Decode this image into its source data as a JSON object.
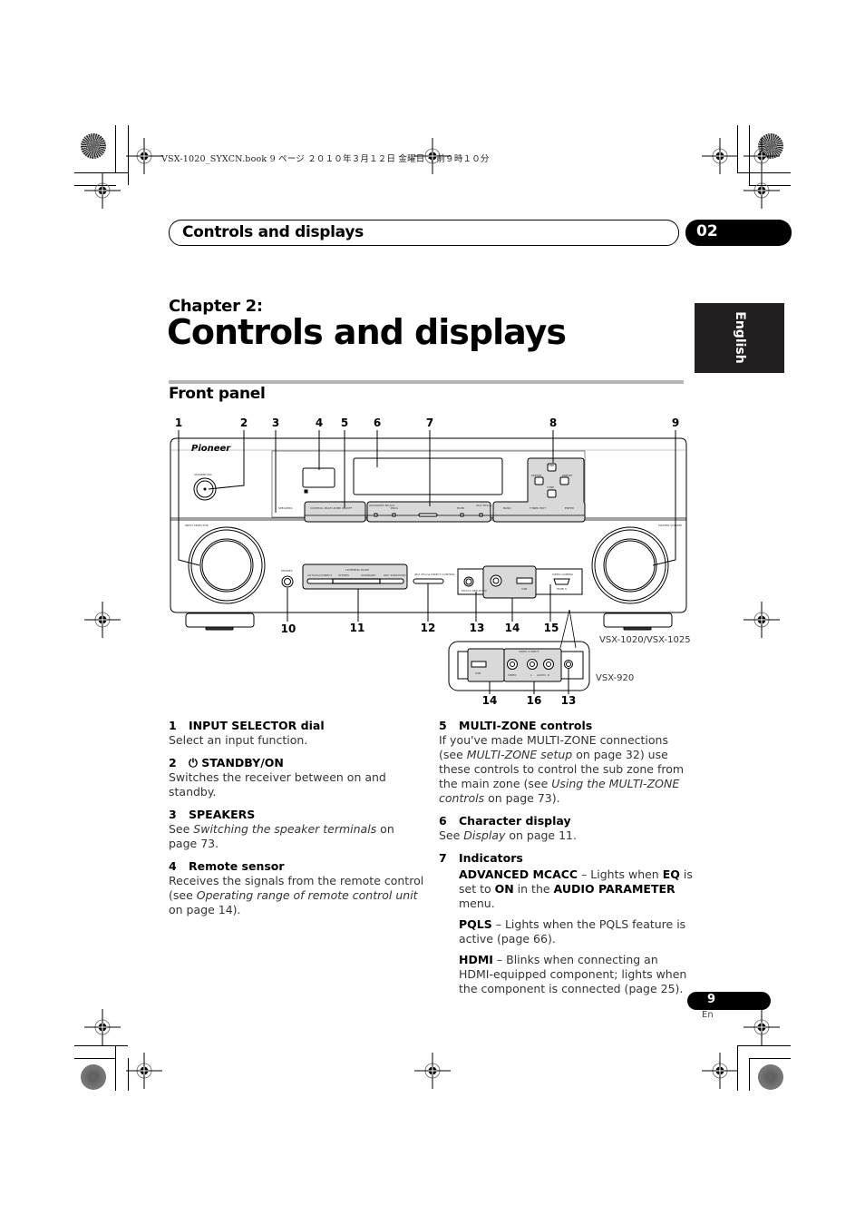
{
  "print_header": "VSX-1020_SYXCN.book  9 ページ  ２０１０年３月１２日  金曜日  午前９時１０分",
  "header": {
    "section_title": "Controls and displays",
    "chapter_number": "02"
  },
  "language_tab": "English",
  "chapter": {
    "label": "Chapter 2:",
    "title": "Controls and displays"
  },
  "section": {
    "heading": "Front panel"
  },
  "diagram": {
    "brand_logo": "Pioneer",
    "callouts_top": [
      "1",
      "2",
      "3",
      "4",
      "5",
      "6",
      "7",
      "8",
      "9"
    ],
    "callouts_bottom": [
      "10",
      "11",
      "12",
      "13",
      "14",
      "15"
    ],
    "callouts_inset": [
      "14",
      "16",
      "13"
    ],
    "model_label_main": "VSX-1020/VSX-1025",
    "model_label_inset": "VSX-920",
    "panel_labels": {
      "standby": "STANDBY/ON",
      "input_selector": "INPUT SELECTOR",
      "master_volume": "MASTER VOLUME",
      "phones": "PHONES",
      "speakers": "SPEAKERS",
      "multi_zone": "CONTROL  MULTI-ZONE  ON/OFF",
      "advanced_mcacc": "ADVANCED MCACC",
      "pqls": "PQLS",
      "hdmi": "HDMI",
      "ipod_iphone": "iPod iPhone",
      "band": "BAND",
      "tuner_edit": "TUNER EDIT",
      "enter": "ENTER",
      "preset_left": "PRESET",
      "preset_right": "PRESET",
      "tune_up": "TUNE",
      "tune_down": "TUNE",
      "listening_mode": "LISTENING MODE",
      "auto_direct": "AUTO/ALC/DIRECT",
      "stereo": "STEREO",
      "standard": "STANDARD",
      "adv_surround": "ADV SURROUND",
      "ipod_direct": "iPod iPhone DIRECT CONTROL",
      "mcacc_mic": "MCACC SETUP MIC",
      "usb": "USB",
      "video_camera": "VIDEO CAMERA",
      "hdmi5": "HDMI 5",
      "video3_input": "VIDEO 3 INPUT",
      "video": "VIDEO",
      "audio_l": "L",
      "audio": "AUDIO",
      "audio_r": "R"
    }
  },
  "items_left": [
    {
      "num": "1",
      "title": "INPUT SELECTOR dial",
      "body_html": "Select an input function."
    },
    {
      "num": "2",
      "title": "⏻ STANDBY/ON",
      "body_html": "Switches the receiver between on and standby."
    },
    {
      "num": "3",
      "title": "SPEAKERS",
      "body_html": "See <i>Switching the speaker terminals</i> on page 73."
    },
    {
      "num": "4",
      "title": "Remote sensor",
      "body_html": "Receives the signals from the remote control (see <i>Operating range of remote control unit</i> on page 14)."
    }
  ],
  "items_right": [
    {
      "num": "5",
      "title": "MULTI-ZONE controls",
      "body_html": "If you've made MULTI-ZONE connections (see <i>MULTI-ZONE setup</i> on page 32) use these controls to control the sub zone from the main zone (see <i>Using the MULTI-ZONE controls</i> on page 73)."
    },
    {
      "num": "6",
      "title": "Character display",
      "body_html": "See <i>Display</i> on page 11."
    },
    {
      "num": "7",
      "title": "Indicators",
      "body_html": ""
    }
  ],
  "indicators": [
    {
      "html": "<b>ADVANCED MCACC</b> – Lights when <b>EQ</b> is set to <b>ON</b> in the <b>AUDIO PARAMETER</b> menu."
    },
    {
      "html": "<b>PQLS</b> – Lights when the PQLS feature is active (page 66)."
    },
    {
      "html": "<b>HDMI</b> – Blinks when connecting an HDMI-equipped component; lights when the component is connected (page 25)."
    }
  ],
  "footer": {
    "page_number": "9",
    "page_lang": "En"
  }
}
